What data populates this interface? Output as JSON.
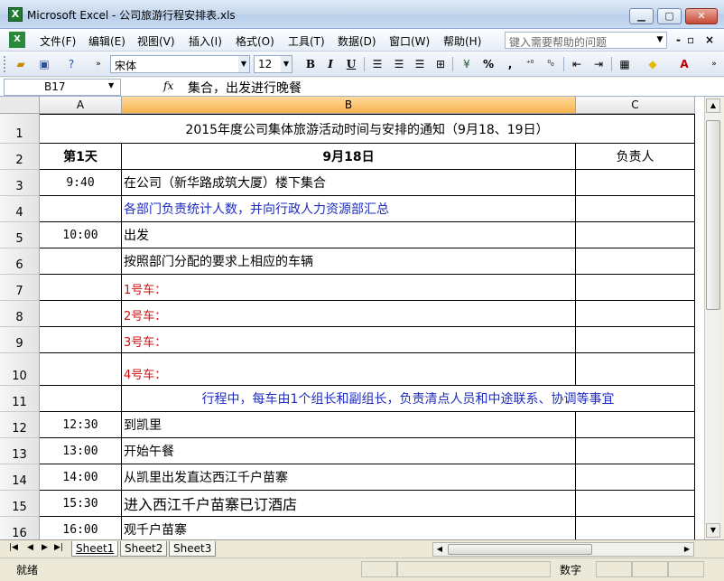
{
  "window": {
    "title": "Microsoft Excel - 公司旅游行程安排表.xls",
    "minimize_icon": "minimize-icon",
    "maximize_icon": "maximize-icon",
    "close_icon": "close-icon"
  },
  "menu": {
    "items": [
      "文件(F)",
      "编辑(E)",
      "视图(V)",
      "插入(I)",
      "格式(O)",
      "工具(T)",
      "数据(D)",
      "窗口(W)",
      "帮助(H)"
    ],
    "help_placeholder": "键入需要帮助的问题"
  },
  "toolbar": {
    "font_name": "宋体",
    "font_size": "12",
    "bold_label": "B",
    "italic_label": "I",
    "underline_label": "U",
    "percent_label": "%",
    "comma_label": ","
  },
  "formula_bar": {
    "cell_ref": "B17",
    "fx_label": "fx",
    "content": "集合，出发进行晚餐"
  },
  "columns": [
    "A",
    "B",
    "C"
  ],
  "rows": [
    {
      "num": "1",
      "a": "",
      "b": "2015年度公司集体旅游活动时间与安排的通知（9月18、19日）",
      "c": ""
    },
    {
      "num": "2",
      "a": "第1天",
      "b": "9月18日",
      "c": "负责人"
    },
    {
      "num": "3",
      "a": "9:40",
      "b": " 在公司（新华路成筑大厦）楼下集合",
      "c": ""
    },
    {
      "num": "4",
      "a": "",
      "b": "各部门负责统计人数，并向行政人力资源部汇总",
      "c": ""
    },
    {
      "num": "5",
      "a": "10:00",
      "b": "出发",
      "c": ""
    },
    {
      "num": "6",
      "a": "",
      "b": "按照部门分配的要求上相应的车辆",
      "c": ""
    },
    {
      "num": "7",
      "a": "",
      "b": "1号车：",
      "c": ""
    },
    {
      "num": "8",
      "a": "",
      "b": "2号车：",
      "c": ""
    },
    {
      "num": "9",
      "a": "",
      "b": "3号车：",
      "c": ""
    },
    {
      "num": "10",
      "a": "",
      "b": "4号车：",
      "c": ""
    },
    {
      "num": "11",
      "a": "",
      "b": "行程中，每车由1个组长和副组长，负责清点人员和中途联系、协调等事宜",
      "c": ""
    },
    {
      "num": "12",
      "a": "12:30",
      "b": "到凯里",
      "c": ""
    },
    {
      "num": "13",
      "a": "13:00",
      "b": "开始午餐",
      "c": ""
    },
    {
      "num": "14",
      "a": "14:00",
      "b": "从凯里出发直达西江千户苗寨",
      "c": ""
    },
    {
      "num": "15",
      "a": "15:30",
      "b": "进入西江千户苗寨已订酒店",
      "c": ""
    },
    {
      "num": "16",
      "a": "16:00",
      "b": "观千户苗寨",
      "c": ""
    }
  ],
  "sheet_tabs": [
    "Sheet1",
    "Sheet2",
    "Sheet3"
  ],
  "status": {
    "left": "就绪",
    "right": "数字"
  },
  "colors": {
    "blue_text": "#1f2cc0",
    "red_text": "#cc1111",
    "selected_column_header": "#f8b44f"
  }
}
